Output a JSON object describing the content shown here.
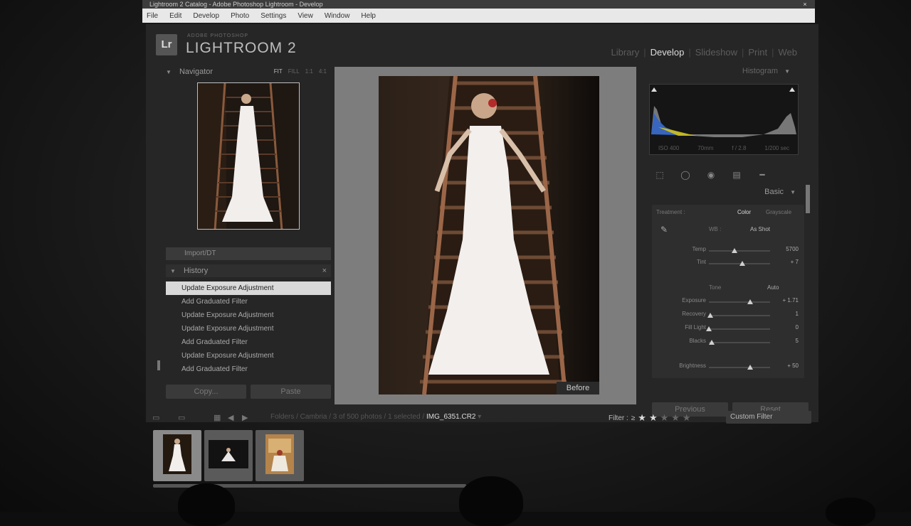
{
  "window": {
    "title": "Lightroom 2 Catalog - Adobe Photoshop Lightroom - Develop",
    "close_label": "×"
  },
  "menu": [
    "File",
    "Edit",
    "Develop",
    "Photo",
    "Settings",
    "View",
    "Window",
    "Help"
  ],
  "app": {
    "logo_mark": "Lr",
    "logo_sub": "ADOBE PHOTOSHOP",
    "logo_name": "LIGHTROOM 2"
  },
  "modules": [
    "Library",
    "Develop",
    "Slideshow",
    "Print",
    "Web"
  ],
  "active_module": "Develop",
  "navigator": {
    "title": "Navigator",
    "zoom": [
      "FIT",
      "FILL",
      "1:1",
      "4:1"
    ]
  },
  "presets": {
    "label": "Import/DT"
  },
  "history": {
    "title": "History",
    "close": "×",
    "items": [
      "Update Exposure Adjustment",
      "Add Graduated Filter",
      "Update Exposure Adjustment",
      "Update Exposure Adjustment",
      "Add Graduated Filter",
      "Update Exposure Adjustment",
      "Add Graduated Filter"
    ],
    "selected_index": 0
  },
  "left_buttons": {
    "copy": "Copy...",
    "paste": "Paste"
  },
  "center": {
    "before_label": "Before"
  },
  "histogram": {
    "title": "Histogram",
    "info": [
      "ISO 400",
      "70mm",
      "f / 2.8",
      "1/200 sec"
    ]
  },
  "basic": {
    "title": "Basic",
    "treatment_label": "Treatment :",
    "treatment_color": "Color",
    "treatment_gray": "Grayscale",
    "wb_label": "WB :",
    "wb_value": "As Shot",
    "sliders_wb": [
      {
        "label": "Temp",
        "value": "5700",
        "pos": 0.42
      },
      {
        "label": "Tint",
        "value": "+ 7",
        "pos": 0.55
      }
    ],
    "tone_label": "Tone",
    "tone_auto": "Auto",
    "sliders_tone": [
      {
        "label": "Exposure",
        "value": "+ 1.71",
        "pos": 0.68
      },
      {
        "label": "Recovery",
        "value": "1",
        "pos": 0.02
      },
      {
        "label": "Fill Light",
        "value": "0",
        "pos": 0.0
      },
      {
        "label": "Blacks",
        "value": "5",
        "pos": 0.05
      }
    ],
    "slider_brightness": {
      "label": "Brightness",
      "value": "+ 50",
      "pos": 0.68
    }
  },
  "right_buttons": {
    "previous": "Previous",
    "reset": "Reset"
  },
  "filmbar": {
    "breadcrumb": "Folders / Cambria / 3 of 500 photos / 1 selected /",
    "filename": "IMG_6351.CR2",
    "filter_label": "Filter :",
    "filter_op": "≥",
    "stars_on": 2,
    "stars_total": 5,
    "custom_filter": "Custom Filter"
  }
}
